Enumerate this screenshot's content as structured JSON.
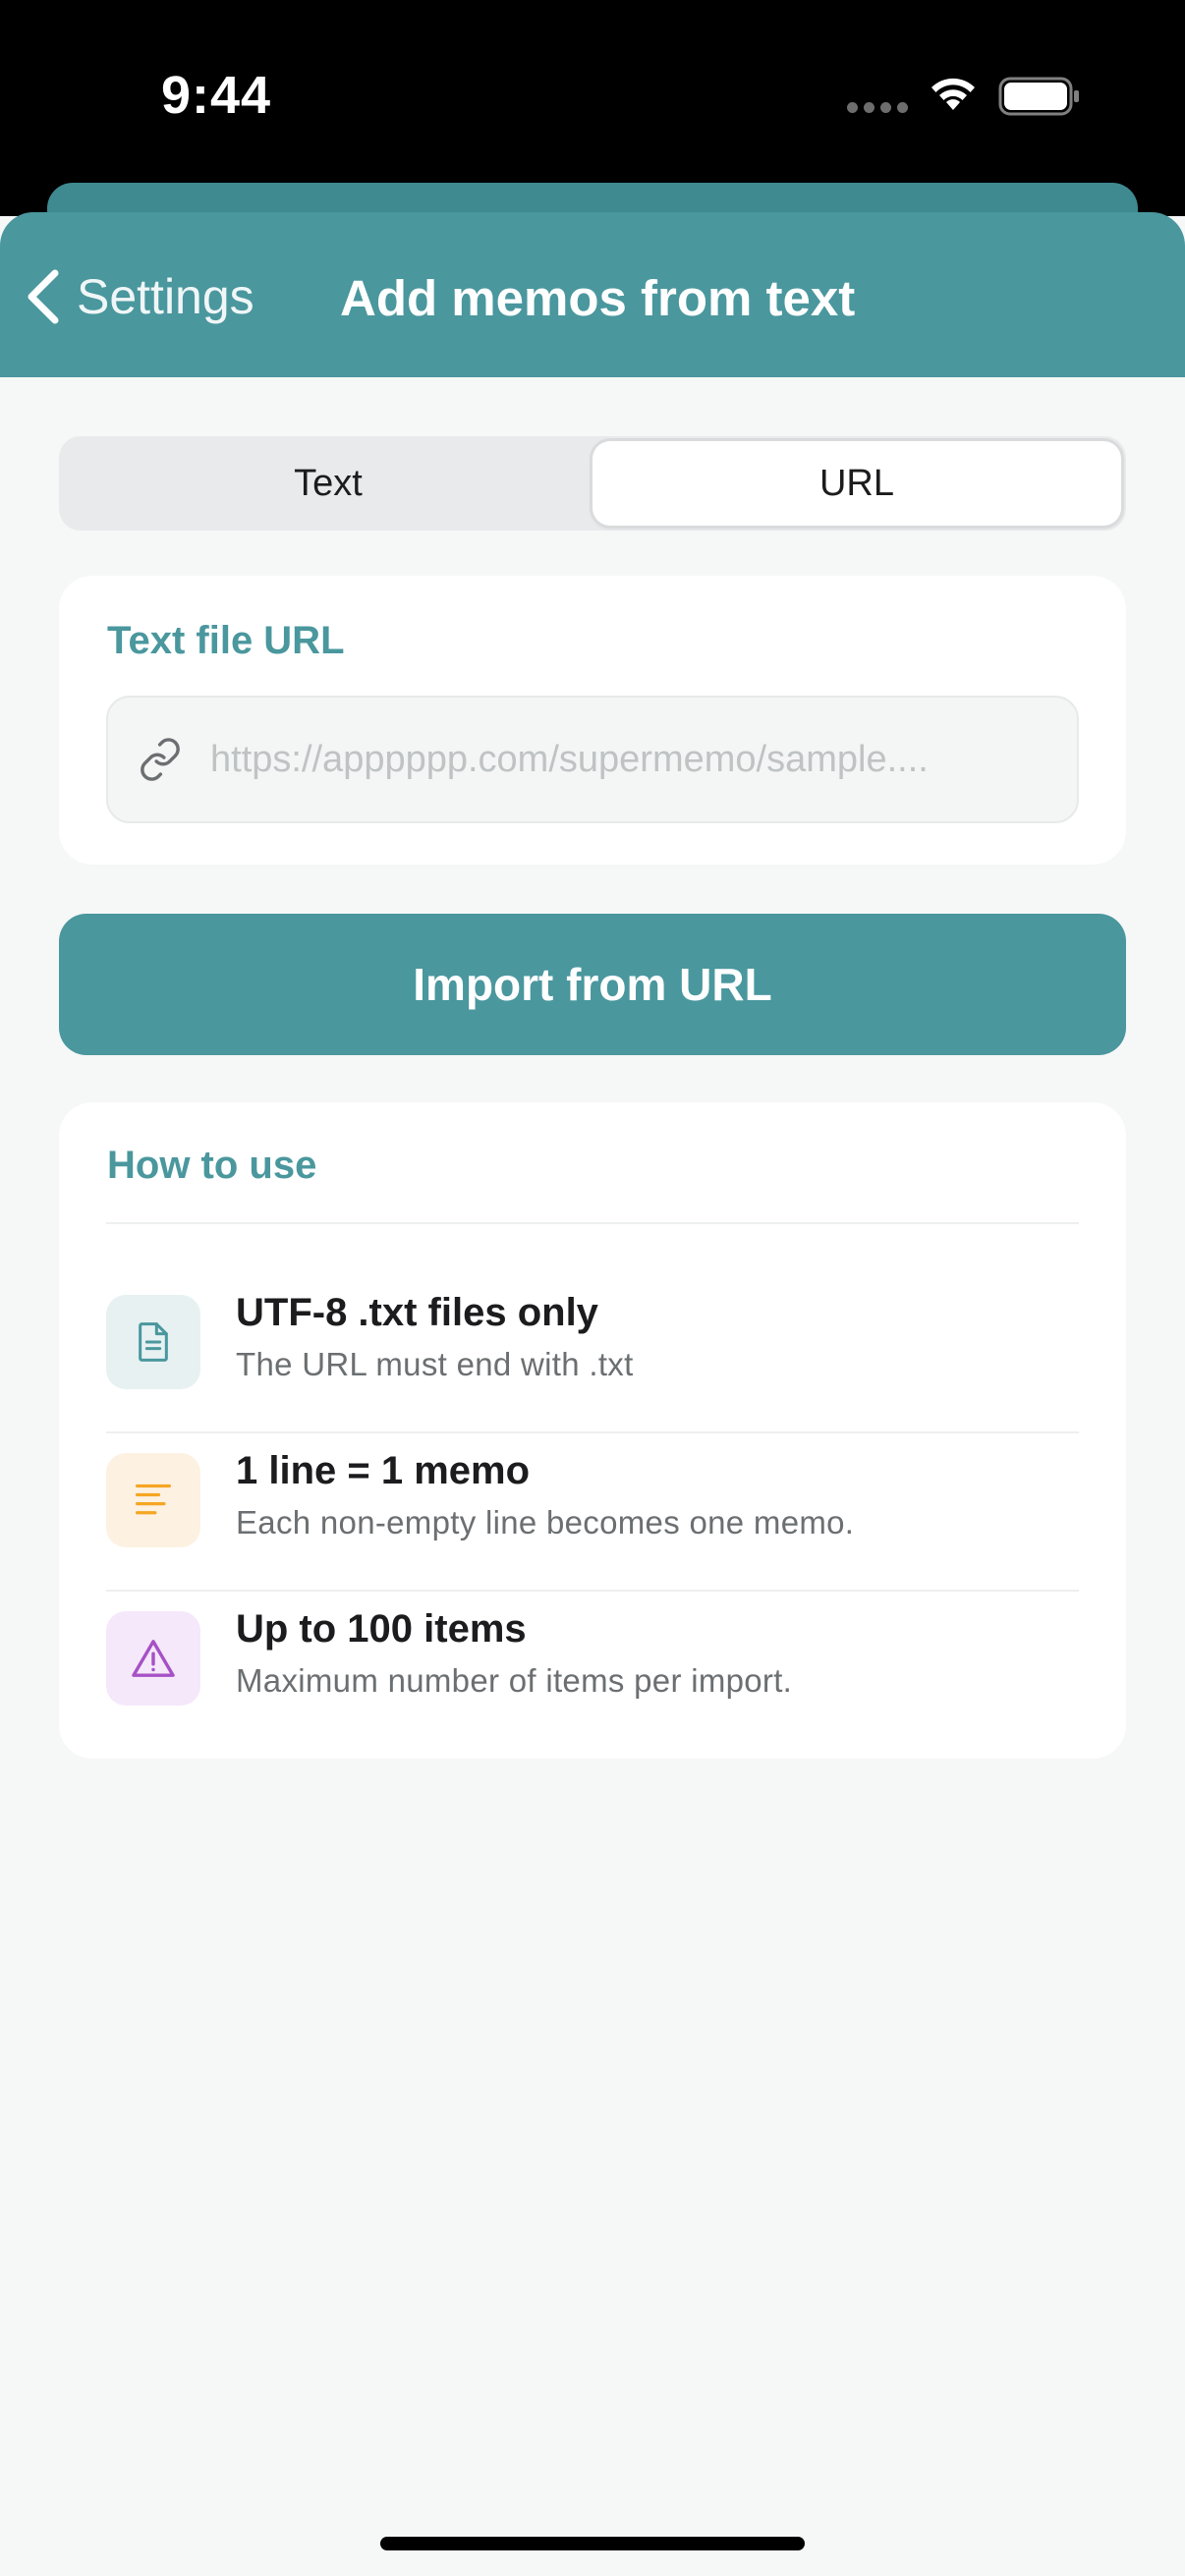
{
  "status_bar": {
    "time": "9:44",
    "icons": [
      "signal-dots-icon",
      "wifi-icon",
      "battery-icon"
    ]
  },
  "nav": {
    "back_label": "Settings",
    "title": "Add memos from text"
  },
  "segmented_control": {
    "options": [
      "Text",
      "URL"
    ],
    "selected": "URL"
  },
  "url_section": {
    "title": "Text file URL",
    "input_value": "",
    "placeholder": "https://apppppp.com/supermemo/sample....",
    "icon": "link-icon"
  },
  "import_button": {
    "label": "Import from URL"
  },
  "help": {
    "title": "How to use",
    "items": [
      {
        "icon": "document-icon",
        "title": "UTF-8 .txt files only",
        "description": "The URL must end with .txt",
        "color": "#4a979e",
        "bg": "#e7f1f2"
      },
      {
        "icon": "lines-icon",
        "title": "1 line = 1 memo",
        "description": "Each non-empty line becomes one memo.",
        "color": "#f5a623",
        "bg": "#fdf1e2"
      },
      {
        "icon": "warning-icon",
        "title": "Up to 100 items",
        "description": "Maximum number of items per import.",
        "color": "#a651c6",
        "bg": "#f5e8fa"
      }
    ]
  },
  "colors": {
    "accent": "#4a979e",
    "background": "#f6f7f7"
  }
}
